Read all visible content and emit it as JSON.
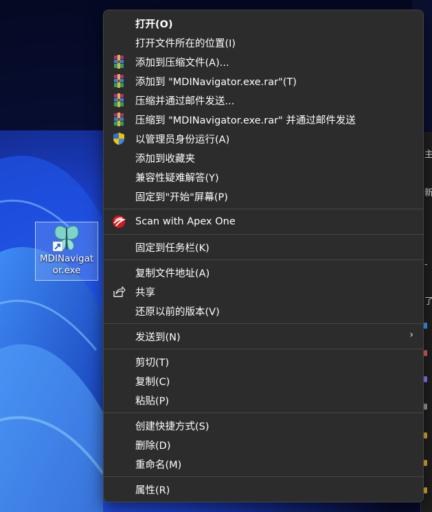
{
  "desktop": {
    "icon": {
      "label": "MDINavigator.exe",
      "icon": "butterfly-app-icon"
    }
  },
  "background_window": {
    "fragments": [
      "主",
      "新",
      "-",
      "了"
    ]
  },
  "menu": {
    "items": [
      {
        "label": "打开(O)",
        "bold": true,
        "icon": ""
      },
      {
        "label": "打开文件所在的位置(I)",
        "icon": ""
      },
      {
        "label": "添加到压缩文件(A)...",
        "icon": "winrar-icon"
      },
      {
        "label": "添加到 \"MDINavigator.exe.rar\"(T)",
        "icon": "winrar-icon"
      },
      {
        "label": "压缩并通过邮件发送...",
        "icon": "winrar-icon"
      },
      {
        "label": "压缩到 \"MDINavigator.exe.rar\" 并通过邮件发送",
        "icon": "winrar-icon"
      },
      {
        "label": "以管理员身份运行(A)",
        "icon": "uac-shield-icon"
      },
      {
        "label": "添加到收藏夹",
        "icon": ""
      },
      {
        "label": "兼容性疑难解答(Y)",
        "icon": ""
      },
      {
        "label": "固定到\"开始\"屏幕(P)",
        "icon": ""
      },
      {
        "label": "Scan with Apex One",
        "icon": "apex-one-icon"
      },
      {
        "label": "固定到任务栏(K)",
        "icon": ""
      },
      {
        "label": "复制文件地址(A)",
        "icon": ""
      },
      {
        "label": "共享",
        "icon": "share-icon"
      },
      {
        "label": "还原以前的版本(V)",
        "icon": ""
      },
      {
        "label": "发送到(N)",
        "icon": "",
        "submenu": true,
        "chevron": "›"
      },
      {
        "label": "剪切(T)",
        "icon": ""
      },
      {
        "label": "复制(C)",
        "icon": ""
      },
      {
        "label": "粘贴(P)",
        "icon": ""
      },
      {
        "label": "创建快捷方式(S)",
        "icon": ""
      },
      {
        "label": "删除(D)",
        "icon": ""
      },
      {
        "label": "重命名(M)",
        "icon": ""
      },
      {
        "label": "属性(R)",
        "icon": ""
      }
    ]
  }
}
